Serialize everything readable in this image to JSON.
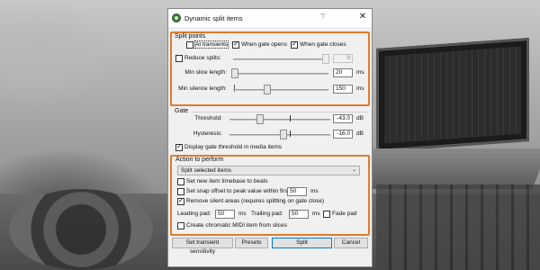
{
  "window": {
    "title": "Dynamic split items"
  },
  "split_points": {
    "group_label": "Split points",
    "at_transients": {
      "label": "At transients",
      "checked": false
    },
    "when_gate_opens": {
      "label": "When gate opens",
      "checked": true
    },
    "when_gate_closes": {
      "label": "When gate closes",
      "checked": true
    },
    "reduce_splits": {
      "label": "Reduce splits:",
      "checked": false,
      "value": "9"
    },
    "min_slice_length": {
      "label": "Min slice length:",
      "value": "20",
      "unit": "ms"
    },
    "min_silence_length": {
      "label": "Min silence length:",
      "value": "150",
      "unit": "ms"
    }
  },
  "gate": {
    "group_label": "Gate",
    "threshold": {
      "label": "Threshold:",
      "value": "-43.0",
      "unit": "dB"
    },
    "hysteresis": {
      "label": "Hysteresis:",
      "value": "-16.0",
      "unit": "dB"
    },
    "display_threshold": {
      "label": "Display gate threshold in media items",
      "checked": true
    }
  },
  "action": {
    "group_label": "Action to perform",
    "selected": "Split selected items",
    "timebase": {
      "label": "Set new item timebase to beats",
      "checked": false
    },
    "snap_offset": {
      "label": "Set snap offset to peak value within first:",
      "checked": false,
      "value": "50",
      "unit": "ms"
    },
    "remove_silence": {
      "label": "Remove silent areas (requires splitting on gate close)",
      "checked": true
    },
    "leading_pad": {
      "label": "Leading pad:",
      "value": "50",
      "unit": "ms"
    },
    "trailing_pad": {
      "label": "Trailing pad:",
      "value": "50",
      "unit": "ms"
    },
    "fade_pad": {
      "label": "Fade pad",
      "checked": false
    },
    "midi": {
      "label": "Create chromatic MIDI item from slices",
      "checked": false
    }
  },
  "buttons": {
    "transient_sensitivity": "Set transient sensitivity",
    "presets": "Presets",
    "split": "Split",
    "cancel": "Cancel"
  },
  "colors": {
    "highlight": "#e07b2a",
    "default_button_border": "#0078d7"
  }
}
